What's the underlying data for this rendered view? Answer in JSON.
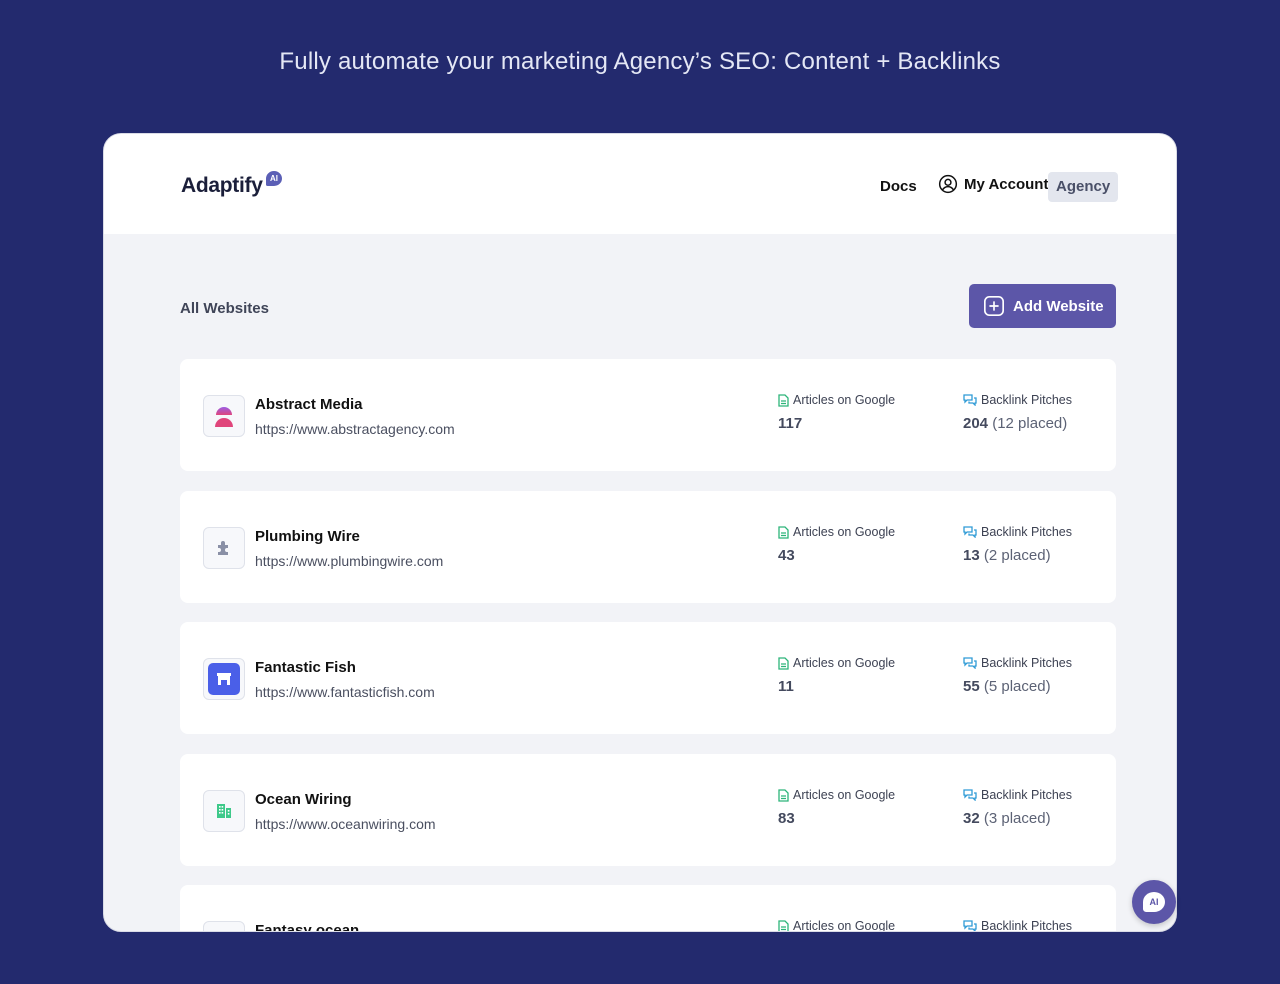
{
  "headline": "Fully automate your marketing Agency’s SEO: Content + Backlinks",
  "header": {
    "logo": "Adaptify",
    "logo_badge": "AI",
    "nav": {
      "docs": "Docs",
      "account": "My Account",
      "agency": "Agency"
    }
  },
  "main": {
    "section_title": "All Websites",
    "add_button": "Add Website",
    "articles_label": "Articles on Google",
    "backlinks_label": "Backlink Pitches",
    "websites": [
      {
        "name": "Abstract Media",
        "url": "https://www.abstractagency.com",
        "articles": "117",
        "pitches": "204",
        "placed": "(12 placed)",
        "icon": "person-avatar-icon"
      },
      {
        "name": "Plumbing Wire",
        "url": "https://www.plumbingwire.com",
        "articles": "43",
        "pitches": "13",
        "placed": "(2 placed)",
        "icon": "puzzle-icon"
      },
      {
        "name": "Fantastic Fish",
        "url": "https://www.fantasticfish.com",
        "articles": "11",
        "pitches": "55",
        "placed": "(5 placed)",
        "icon": "storefront-icon"
      },
      {
        "name": "Ocean Wiring",
        "url": "https://www.oceanwiring.com",
        "articles": "83",
        "pitches": "32",
        "placed": "(3 placed)",
        "icon": "building-icon"
      },
      {
        "name": "Fantasy ocean",
        "url": "",
        "articles": "",
        "pitches": "",
        "placed": "",
        "icon": "site-icon"
      }
    ]
  },
  "chat_badge": "AI",
  "colors": {
    "background": "#232a6e",
    "accent": "#5c56a8",
    "articles_icon": "#2db57a",
    "backlinks_icon": "#2f9bd6"
  }
}
